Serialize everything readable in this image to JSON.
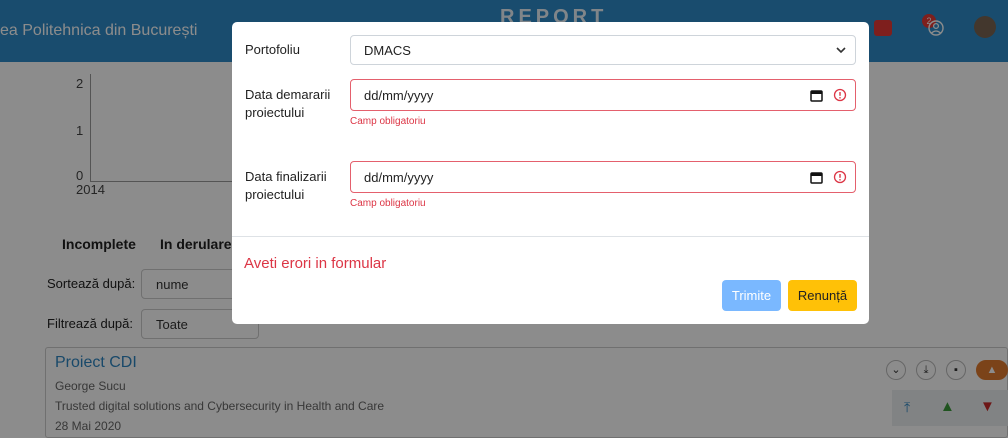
{
  "header": {
    "brand": "ea Politehnica din București",
    "logo": "REPORT",
    "notification_count": "2"
  },
  "chart_data": {
    "type": "line",
    "y_ticks": [
      "2",
      "1",
      "0"
    ],
    "x_ticks": [
      "2014"
    ]
  },
  "tabs": [
    "Incomplete",
    "In derulare"
  ],
  "sort": {
    "label": "Sortează după:",
    "value": "nume"
  },
  "filter": {
    "label": "Filtrează după:",
    "value": "Toate"
  },
  "project": {
    "title": "Proiect CDI",
    "author": "George Sucu",
    "description": "Trusted digital solutions and Cybersecurity in Health and Care",
    "date": "28 Mai 2020"
  },
  "modal": {
    "portfolio_label": "Portofoliu",
    "portfolio_value": "DMACS",
    "start_label": "Data demararii proiectului",
    "start_placeholder": "dd/mm/yyyy",
    "start_error": "Camp obligatoriu",
    "end_label": "Data finalizarii proiectului",
    "end_placeholder": "dd/mm/yyyy",
    "end_error": "Camp obligatoriu",
    "form_error": "Aveti erori in formular",
    "submit_label": "Trimite",
    "cancel_label": "Renunță"
  },
  "colors": {
    "header": "#2e8bc9",
    "error": "#dc3545",
    "submit": "#7ab8ff",
    "cancel": "#ffc107"
  }
}
